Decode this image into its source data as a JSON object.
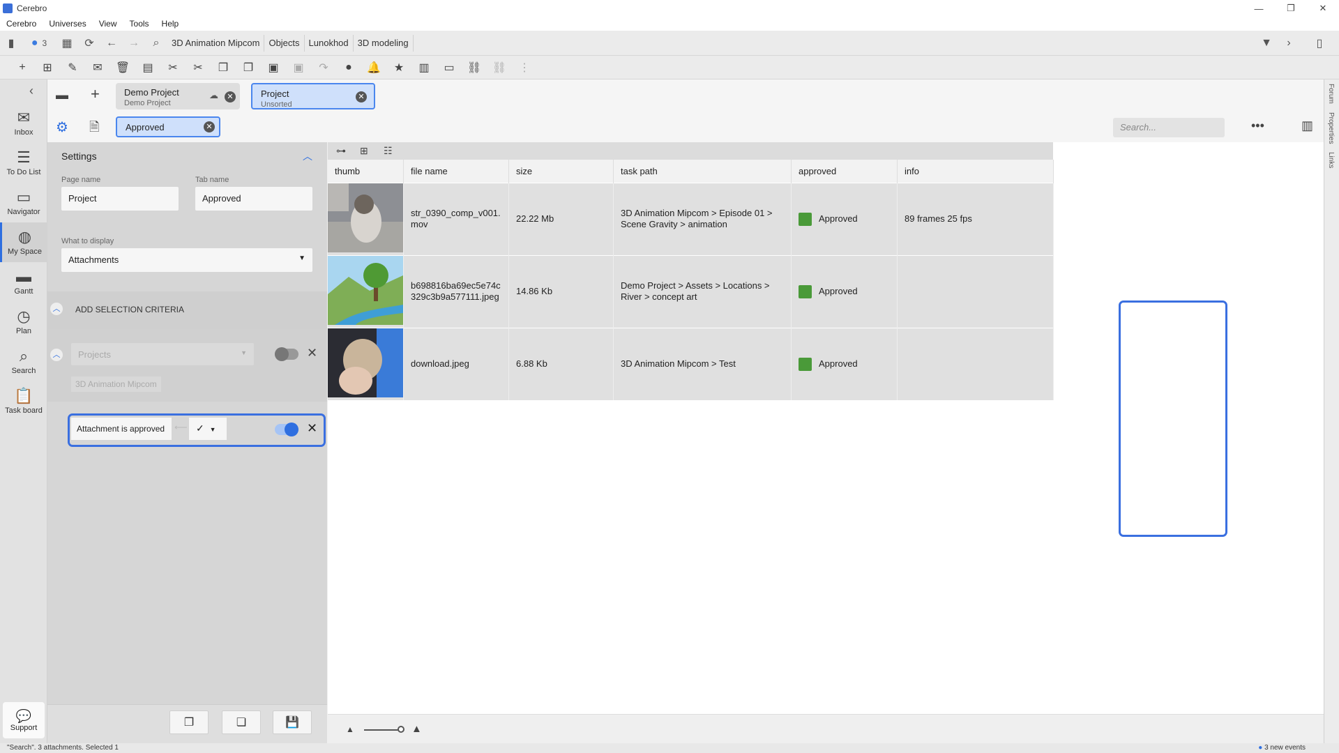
{
  "window": {
    "title": "Cerebro",
    "min": "—",
    "max": "❐",
    "close": "✕"
  },
  "menu": [
    "Cerebro",
    "Universes",
    "View",
    "Tools",
    "Help"
  ],
  "toolbar1": {
    "notifications_count": "3",
    "breadcrumbs": [
      "3D Animation Mipcom",
      "Objects",
      "Lunokhod",
      "3D modeling"
    ]
  },
  "leftnav": {
    "items": [
      {
        "label": "Inbox",
        "icon": "mail-icon"
      },
      {
        "label": "To Do List",
        "icon": "list-icon"
      },
      {
        "label": "Navigator",
        "icon": "folder-icon"
      },
      {
        "label": "My Space",
        "icon": "globe-icon"
      },
      {
        "label": "Gantt",
        "icon": "gantt-icon"
      },
      {
        "label": "Plan",
        "icon": "clock-icon"
      },
      {
        "label": "Search",
        "icon": "search-icon"
      },
      {
        "label": "Task board",
        "icon": "clipboard-icon"
      }
    ],
    "support": "Support"
  },
  "tabs": [
    {
      "title": "Demo Project",
      "subtitle": "Demo Project"
    },
    {
      "title": "Project",
      "subtitle": "Unsorted"
    }
  ],
  "filter": {
    "chip_label": "Approved",
    "search_placeholder": "Search..."
  },
  "settings": {
    "title": "Settings",
    "page_name_label": "Page name",
    "page_name_value": "Project",
    "tab_name_label": "Tab name",
    "tab_name_value": "Approved",
    "display_label": "What to display",
    "display_value": "Attachments",
    "criteria_title": "ADD SELECTION CRITERIA",
    "criteria1_field": "Projects",
    "criteria1_value": "3D Animation Mipcom",
    "criteria2_field": "Attachment is approved",
    "criteria1_enabled": false,
    "criteria2_enabled": true
  },
  "grid": {
    "columns": [
      "thumb",
      "file name",
      "size",
      "task path",
      "approved",
      "info"
    ],
    "rows": [
      {
        "file": "str_0390_comp_v001.\nmov",
        "size": "22.22 Mb",
        "path": "3D Animation Mipcom > Episode 01 > Scene Gravity > animation",
        "approved": "Approved",
        "info": "89 frames 25 fps"
      },
      {
        "file": "b698816ba69ec5e74c329c3b9a577111.jpeg",
        "size": "14.86 Kb",
        "path": "Demo Project > Assets > Locations > River > concept art",
        "approved": "Approved",
        "info": ""
      },
      {
        "file": "download.jpeg",
        "size": "6.88 Kb",
        "path": "3D Animation Mipcom > Test",
        "approved": "Approved",
        "info": ""
      }
    ]
  },
  "rightstrip": [
    "Forum",
    "Properties",
    "Links"
  ],
  "status": {
    "left": "\"Search\". 3 attachments. Selected 1",
    "right": "3 new events"
  }
}
